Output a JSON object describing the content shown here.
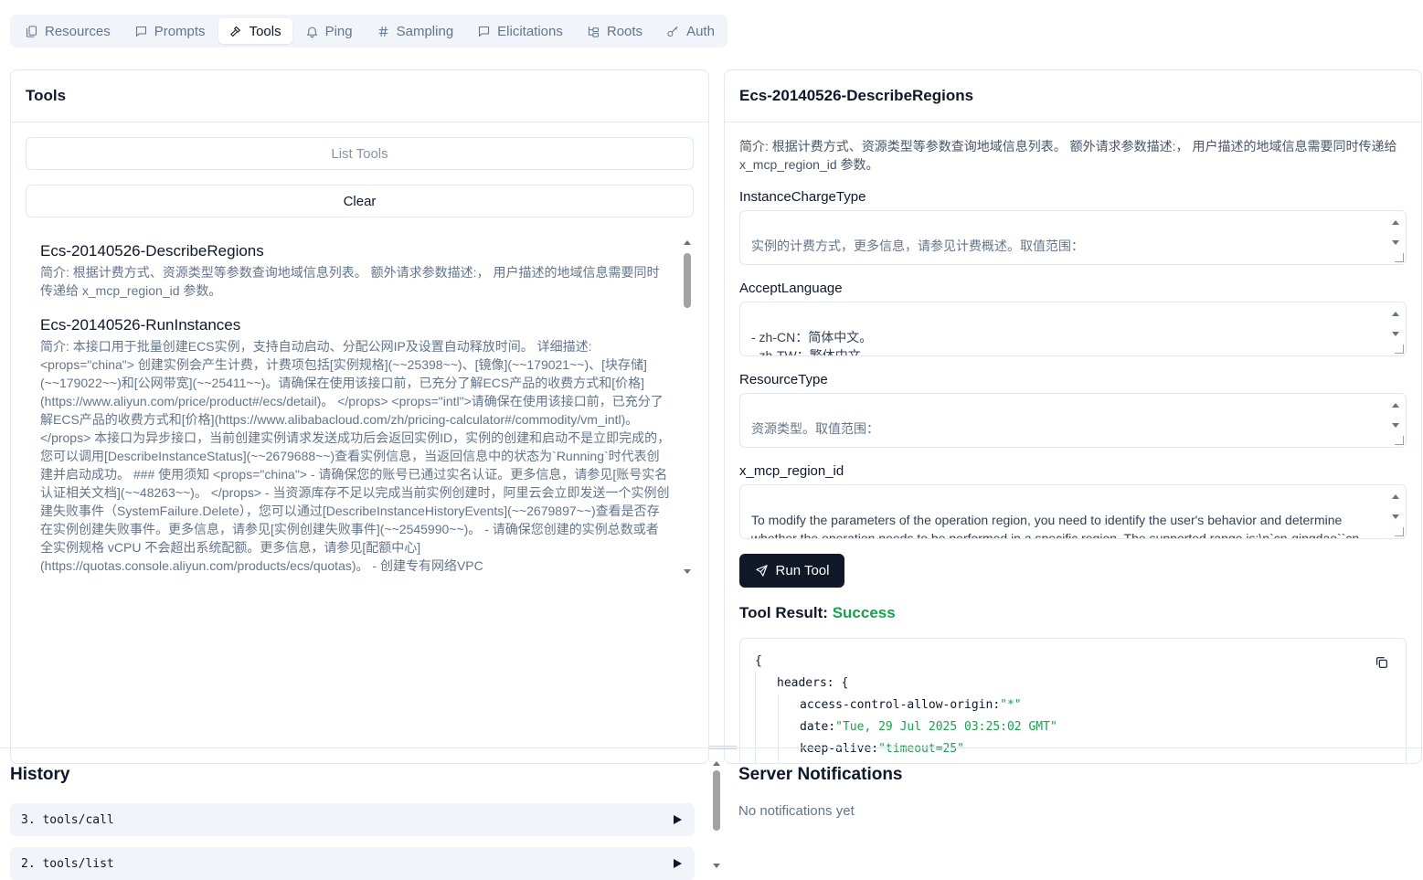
{
  "tabs": [
    {
      "label": "Resources",
      "icon": "files-icon"
    },
    {
      "label": "Prompts",
      "icon": "message-icon"
    },
    {
      "label": "Tools",
      "icon": "hammer-icon",
      "active": true
    },
    {
      "label": "Ping",
      "icon": "bell-icon"
    },
    {
      "label": "Sampling",
      "icon": "hash-icon"
    },
    {
      "label": "Elicitations",
      "icon": "message-square-icon"
    },
    {
      "label": "Roots",
      "icon": "folder-tree-icon"
    },
    {
      "label": "Auth",
      "icon": "key-icon"
    }
  ],
  "tools_panel": {
    "title": "Tools",
    "list_button": "List Tools",
    "clear_button": "Clear",
    "items": [
      {
        "name": "Ecs-20140526-DescribeRegions",
        "desc": "简介: 根据计费方式、资源类型等参数查询地域信息列表。 额外请求参数描述:， 用户描述的地域信息需要同时传递给 x_mcp_region_id 参数。"
      },
      {
        "name": "Ecs-20140526-RunInstances",
        "desc": "简介: 本接口用于批量创建ECS实例，支持自动启动、分配公网IP及设置自动释放时间。 详细描述: <props=\"china\"> 创建实例会产生计费，计费项包括[实例规格](~~25398~~)、[镜像](~~179021~~)、[块存储](~~179022~~)和[公网带宽](~~25411~~)。请确保在使用该接口前，已充分了解ECS产品的收费方式和[价格](https://www.aliyun.com/price/product#/ecs/detail)。 </props> <props=\"intl\">请确保在使用该接口前，已充分了解ECS产品的收费方式和[价格](https://www.alibabacloud.com/zh/pricing-calculator#/commodity/vm_intl)。 </props> 本接口为异步接口，当前创建实例请求发送成功后会返回实例ID，实例的创建和启动不是立即完成的，您可以调用[DescribeInstanceStatus](~~2679688~~)查看实例信息，当返回信息中的状态为`Running`时代表创建并启动成功。 ### 使用须知 <props=\"china\"> - 请确保您的账号已通过实名认证。更多信息，请参见[账号实名认证相关文档](~~48263~~)。 </props> - 当资源库存不足以完成当前实例创建时，阿里云会立即发送一个实例创建失败事件（SystemFailure.Delete），您可以通过[DescribeInstanceHistoryEvents](~~2679897~~)查看是否存在实例创建失败事件。更多信息，请参见[实例创建失败事件](~~2545990~~)。 - 请确保您创建的实例总数或者全实例规格 vCPU 不会超出系统配额。更多信息，请参见[配额中心](https://quotas.console.aliyun.com/products/ecs/quotas)。 - 创建专有网络VPC"
      }
    ]
  },
  "detail_panel": {
    "title": "Ecs-20140526-DescribeRegions",
    "desc": "简介: 根据计费方式、资源类型等参数查询地域信息列表。 额外请求参数描述:， 用户描述的地域信息需要同时传递给 x_mcp_region_id 参数。",
    "fields": [
      {
        "label": "InstanceChargeType",
        "value": "实例的计费方式，更多信息，请参见计费概述。取值范围：\n\n- PrePaid：包年包月。此时，请确认自己的账号支持余额支付或者信用支付，否则将报错InvalidPayMethod。"
      },
      {
        "label": "AcceptLanguage",
        "value": "- zh-CN：简体中文。\n- zh-TW：繁体中文。\n- en-US：英文。"
      },
      {
        "label": "ResourceType",
        "value": "资源类型。取值范围：\n\n- instance：ECS实例。"
      },
      {
        "label": "x_mcp_region_id",
        "value": "To modify the parameters of the operation region, you need to identify the user's behavior and determine whether the operation needs to be performed in a specific region. The supported range is:\\n`cn-qingdao``cn-beijing``cn-zhangjiakou``cn-zhengzhou-jva``cn-huhehaote``cn-wulanchabu``cn"
      }
    ],
    "run_button": "Run Tool",
    "result_label": "Tool Result:",
    "result_status": "Success",
    "result_json": {
      "open_brace": "{",
      "headers_key": "headers:",
      "headers_open": "{",
      "lines": [
        {
          "key": "access-control-allow-origin:",
          "value": "\"*\""
        },
        {
          "key": "date:",
          "value": "\"Tue, 29 Jul 2025 03:25:02 GMT\""
        },
        {
          "key": "keep-alive:",
          "value": "\"timeout=25\""
        }
      ]
    }
  },
  "history": {
    "title": "History",
    "items": [
      {
        "label": "3. tools/call"
      },
      {
        "label": "2. tools/list"
      }
    ]
  },
  "notifications": {
    "title": "Server Notifications",
    "empty": "No notifications yet"
  },
  "colors": {
    "success": "#16a34a",
    "primary_button": "#111827"
  }
}
